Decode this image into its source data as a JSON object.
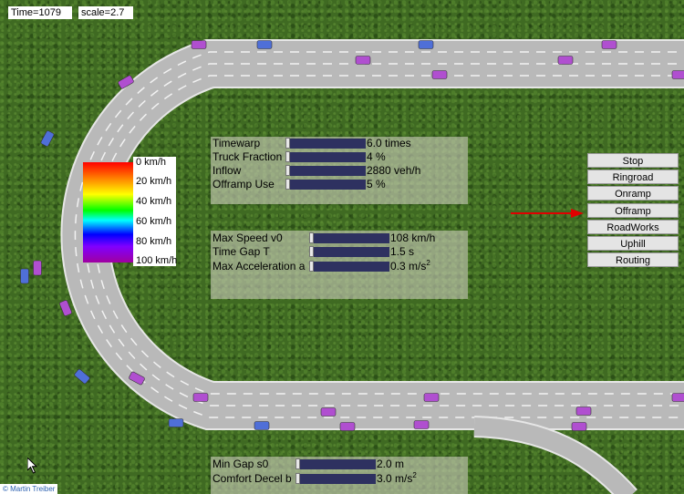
{
  "hud": {
    "time": "Time=1079",
    "scale": "scale=2.7"
  },
  "panel_top": {
    "rows": [
      {
        "label": "Timewarp",
        "value": "6.0 times",
        "fraction": 0.0
      },
      {
        "label": "Truck Fraction",
        "value": "4 %",
        "fraction": 0.0
      },
      {
        "label": "Inflow",
        "value": "2880 veh/h",
        "fraction": 0.0
      },
      {
        "label": "Offramp Use",
        "value": "5 %",
        "fraction": 0.0
      }
    ]
  },
  "panel_mid": {
    "rows": [
      {
        "label": "Max Speed v0",
        "value": "108 km/h",
        "unit_sup": ""
      },
      {
        "label": "Time Gap T",
        "value": "1.5 s",
        "unit_sup": ""
      },
      {
        "label": "Max Acceleration a",
        "value": "0.3 m/s",
        "unit_sup": "2"
      }
    ]
  },
  "panel_bottom": {
    "rows": [
      {
        "label": "Min Gap s0",
        "value": "2.0 m",
        "unit_sup": ""
      },
      {
        "label": "Comfort Decel b",
        "value": "3.0 m/s",
        "unit_sup": "2"
      }
    ]
  },
  "legend": {
    "labels": [
      "0 km/h",
      "20 km/h",
      "40 km/h",
      "60 km/h",
      "80 km/h",
      "100 km/h"
    ]
  },
  "scenario_buttons": [
    "Stop",
    "Ringroad",
    "Onramp",
    "Offramp",
    "RoadWorks",
    "Uphill",
    "Routing"
  ],
  "active_scenario": "Offramp",
  "colors": {
    "grass": "#3f6a22",
    "road": "#b9b9b9",
    "slider": "#2e3160",
    "arrow": "#e00000",
    "car_purple": "#b04fd0",
    "car_blue": "#4f6fd8"
  },
  "credit": "© Martin Treiber",
  "icons": {
    "cursor": "mouse-pointer-icon",
    "arrow": "red-arrow-icon"
  }
}
